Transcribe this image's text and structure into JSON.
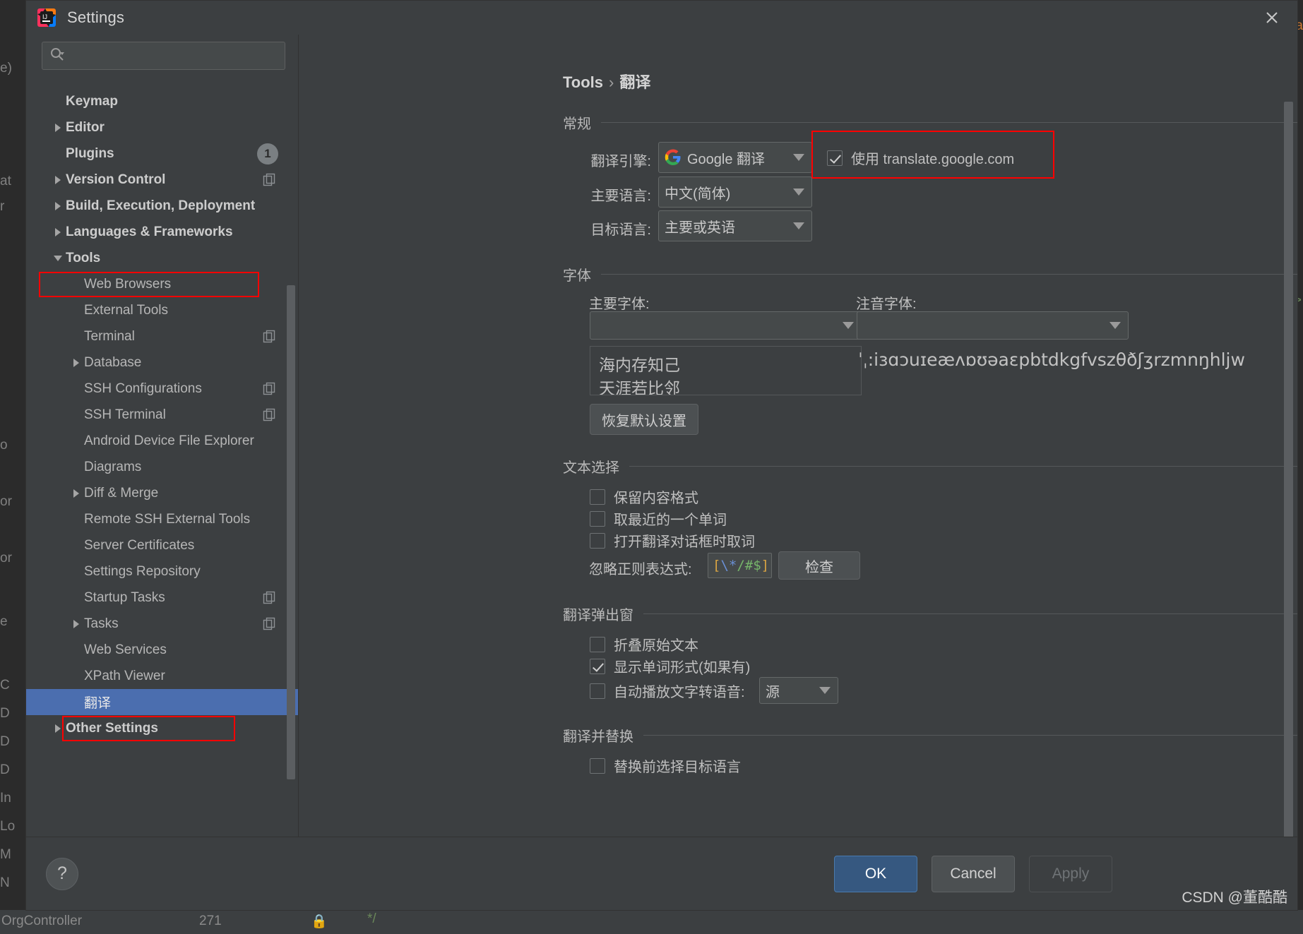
{
  "window": {
    "title": "Settings",
    "app_icon": "intellij-idea-icon",
    "close_icon": "close-icon"
  },
  "search": {
    "icon": "search-icon",
    "value": "",
    "placeholder": ""
  },
  "sidebar": {
    "scrollbar": "sidebar-scrollbar",
    "items": [
      {
        "label": "Keymap",
        "depth": 0,
        "arrow": "none",
        "badge": null,
        "copy": false,
        "selected": false
      },
      {
        "label": "Editor",
        "depth": 0,
        "arrow": "collapsed",
        "badge": null,
        "copy": false,
        "selected": false
      },
      {
        "label": "Plugins",
        "depth": 0,
        "arrow": "none",
        "badge": "1",
        "copy": false,
        "selected": false
      },
      {
        "label": "Version Control",
        "depth": 0,
        "arrow": "collapsed",
        "badge": null,
        "copy": true,
        "selected": false
      },
      {
        "label": "Build, Execution, Deployment",
        "depth": 0,
        "arrow": "collapsed",
        "badge": null,
        "copy": false,
        "selected": false
      },
      {
        "label": "Languages & Frameworks",
        "depth": 0,
        "arrow": "collapsed",
        "badge": null,
        "copy": false,
        "selected": false
      },
      {
        "label": "Tools",
        "depth": 0,
        "arrow": "expanded",
        "badge": null,
        "copy": false,
        "selected": false
      },
      {
        "label": "Web Browsers",
        "depth": 1,
        "arrow": "none",
        "badge": null,
        "copy": false,
        "selected": false
      },
      {
        "label": "External Tools",
        "depth": 1,
        "arrow": "none",
        "badge": null,
        "copy": false,
        "selected": false
      },
      {
        "label": "Terminal",
        "depth": 1,
        "arrow": "none",
        "badge": null,
        "copy": true,
        "selected": false
      },
      {
        "label": "Database",
        "depth": 1,
        "arrow": "collapsed",
        "badge": null,
        "copy": false,
        "selected": false
      },
      {
        "label": "SSH Configurations",
        "depth": 1,
        "arrow": "none",
        "badge": null,
        "copy": true,
        "selected": false
      },
      {
        "label": "SSH Terminal",
        "depth": 1,
        "arrow": "none",
        "badge": null,
        "copy": true,
        "selected": false
      },
      {
        "label": "Android Device File Explorer",
        "depth": 1,
        "arrow": "none",
        "badge": null,
        "copy": false,
        "selected": false
      },
      {
        "label": "Diagrams",
        "depth": 1,
        "arrow": "none",
        "badge": null,
        "copy": false,
        "selected": false
      },
      {
        "label": "Diff & Merge",
        "depth": 1,
        "arrow": "collapsed",
        "badge": null,
        "copy": false,
        "selected": false
      },
      {
        "label": "Remote SSH External Tools",
        "depth": 1,
        "arrow": "none",
        "badge": null,
        "copy": false,
        "selected": false
      },
      {
        "label": "Server Certificates",
        "depth": 1,
        "arrow": "none",
        "badge": null,
        "copy": false,
        "selected": false
      },
      {
        "label": "Settings Repository",
        "depth": 1,
        "arrow": "none",
        "badge": null,
        "copy": false,
        "selected": false
      },
      {
        "label": "Startup Tasks",
        "depth": 1,
        "arrow": "none",
        "badge": null,
        "copy": true,
        "selected": false
      },
      {
        "label": "Tasks",
        "depth": 1,
        "arrow": "collapsed",
        "badge": null,
        "copy": true,
        "selected": false
      },
      {
        "label": "Web Services",
        "depth": 1,
        "arrow": "none",
        "badge": null,
        "copy": false,
        "selected": false
      },
      {
        "label": "XPath Viewer",
        "depth": 1,
        "arrow": "none",
        "badge": null,
        "copy": false,
        "selected": false
      },
      {
        "label": "翻译",
        "depth": 1,
        "arrow": "none",
        "badge": null,
        "copy": false,
        "selected": true
      },
      {
        "label": "Other Settings",
        "depth": 0,
        "arrow": "collapsed",
        "badge": null,
        "copy": false,
        "selected": false
      }
    ]
  },
  "breadcrumb": {
    "root": "Tools",
    "separator": "›",
    "leaf": "翻译"
  },
  "general": {
    "section_label": "常规",
    "engine_label": "翻译引擎:",
    "engine_value": "Google 翻译",
    "engine_icon": "google-g-icon",
    "primary_lang_label": "主要语言:",
    "primary_lang_value": "中文(简体)",
    "target_lang_label": "目标语言:",
    "target_lang_value": "主要或英语",
    "use_translate_google_label": "使用 translate.google.com",
    "use_translate_google_checked": true
  },
  "font": {
    "section_label": "字体",
    "primary_font_label": "主要字体:",
    "primary_font_value": "",
    "phonetic_font_label": "注音字体:",
    "phonetic_font_value": "",
    "primary_preview": "海内存知己\n天涯若比邻",
    "phonetic_preview": "ˈˌ:iɜɑɔuɪeæʌɒʊəaɛpbtdkgfvszθðʃʒrzmnŋhljw",
    "reset_button": "恢复默认设置"
  },
  "text_selection": {
    "section_label": "文本选择",
    "options": [
      {
        "label": "保留内容格式",
        "checked": false
      },
      {
        "label": "取最近的一个单词",
        "checked": false
      },
      {
        "label": "打开翻译对话框时取词",
        "checked": false
      }
    ],
    "regex_label": "忽略正则表达式:",
    "regex_value": "[\\*/#$]",
    "regex_tokens": [
      {
        "t": "[",
        "k": "br"
      },
      {
        "t": "\\*",
        "k": "esc"
      },
      {
        "t": "/#$",
        "k": "lit"
      },
      {
        "t": "]",
        "k": "br"
      }
    ],
    "check_button": "检查"
  },
  "translate_popup": {
    "section_label": "翻译弹出窗",
    "options": [
      {
        "label": "折叠原始文本",
        "checked": false
      },
      {
        "label": "显示单词形式(如果有)",
        "checked": true
      }
    ],
    "tts_label": "自动播放文字转语音:",
    "tts_checked": false,
    "tts_value": "源"
  },
  "translate_replace": {
    "section_label": "翻译并替换",
    "options": [
      {
        "label": "替换前选择目标语言",
        "checked": false
      }
    ]
  },
  "footer": {
    "help_label": "?",
    "ok_label": "OK",
    "cancel_label": "Cancel",
    "apply_label": "Apply",
    "watermark": "CSDN @董酷酷"
  },
  "background_ide": {
    "gutter_lines": [
      "e)",
      "",
      "at",
      "r",
      "",
      "",
      "o",
      "",
      "or",
      "",
      "e",
      "C",
      "D",
      "D",
      "D",
      "In",
      "Lo",
      "M",
      "N",
      "Org"
    ],
    "right_text": "a",
    "status_text": "OrgController",
    "status_text2": "271"
  },
  "colors": {
    "dialog_bg": "#3c3f41",
    "selection_blue": "#4b6eaf",
    "ok_blue": "#365880",
    "highlight_red": "#ff0000",
    "text": "#b6b6b6"
  }
}
